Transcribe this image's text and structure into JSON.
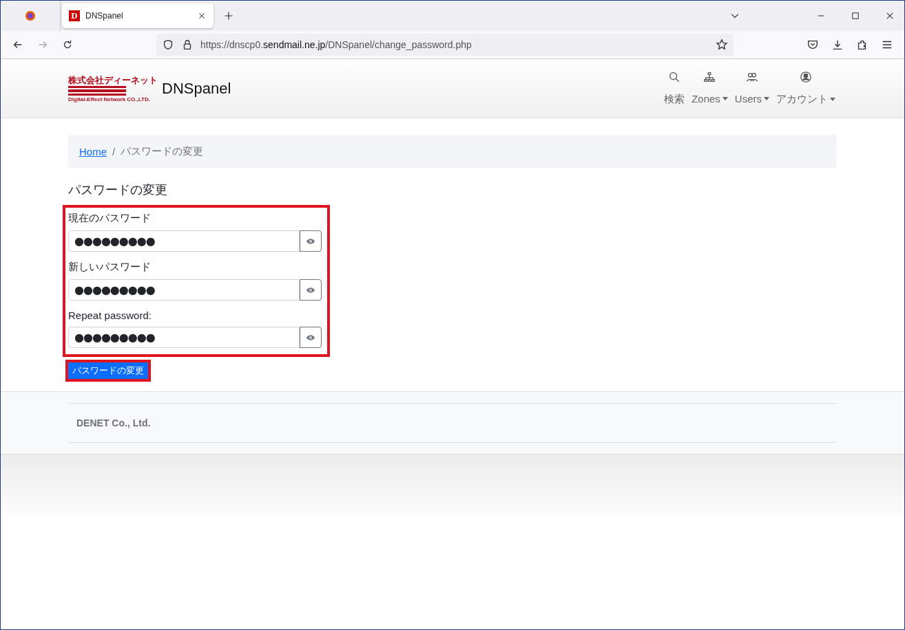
{
  "browser": {
    "tab": {
      "favicon_letter": "D",
      "title": "DNSpanel",
      "selected": true
    },
    "url": {
      "scheme": "https://dnscp0.",
      "domain": "sendmail.ne.jp",
      "path": "/DNSpanel/change_password.php"
    }
  },
  "header": {
    "logo": {
      "company": "株式会社ディーネット",
      "tagline": "Digital-Effect Network CO.,LTD."
    },
    "brand": "DNSpanel",
    "nav": [
      {
        "kind": "search",
        "label": "検索",
        "dropdown": false
      },
      {
        "kind": "zones",
        "label": "Zones",
        "dropdown": true
      },
      {
        "kind": "users",
        "label": "Users",
        "dropdown": true
      },
      {
        "kind": "account",
        "label": "アカウント",
        "dropdown": true
      }
    ]
  },
  "breadcrumb_separator": "/",
  "breadcrumb": [
    {
      "label": "Home",
      "link": true
    },
    {
      "label": "パスワードの変更",
      "link": false
    }
  ],
  "heading": "パスワードの変更",
  "fields": [
    {
      "label": "現在のパスワード",
      "value": "●●●●●●●●●"
    },
    {
      "label": "新しいパスワード",
      "value": "●●●●●●●●●"
    },
    {
      "label": "Repeat password:",
      "value": "●●●●●●●●●"
    }
  ],
  "submit": "パスワードの変更",
  "footer": "DENET Co., Ltd."
}
